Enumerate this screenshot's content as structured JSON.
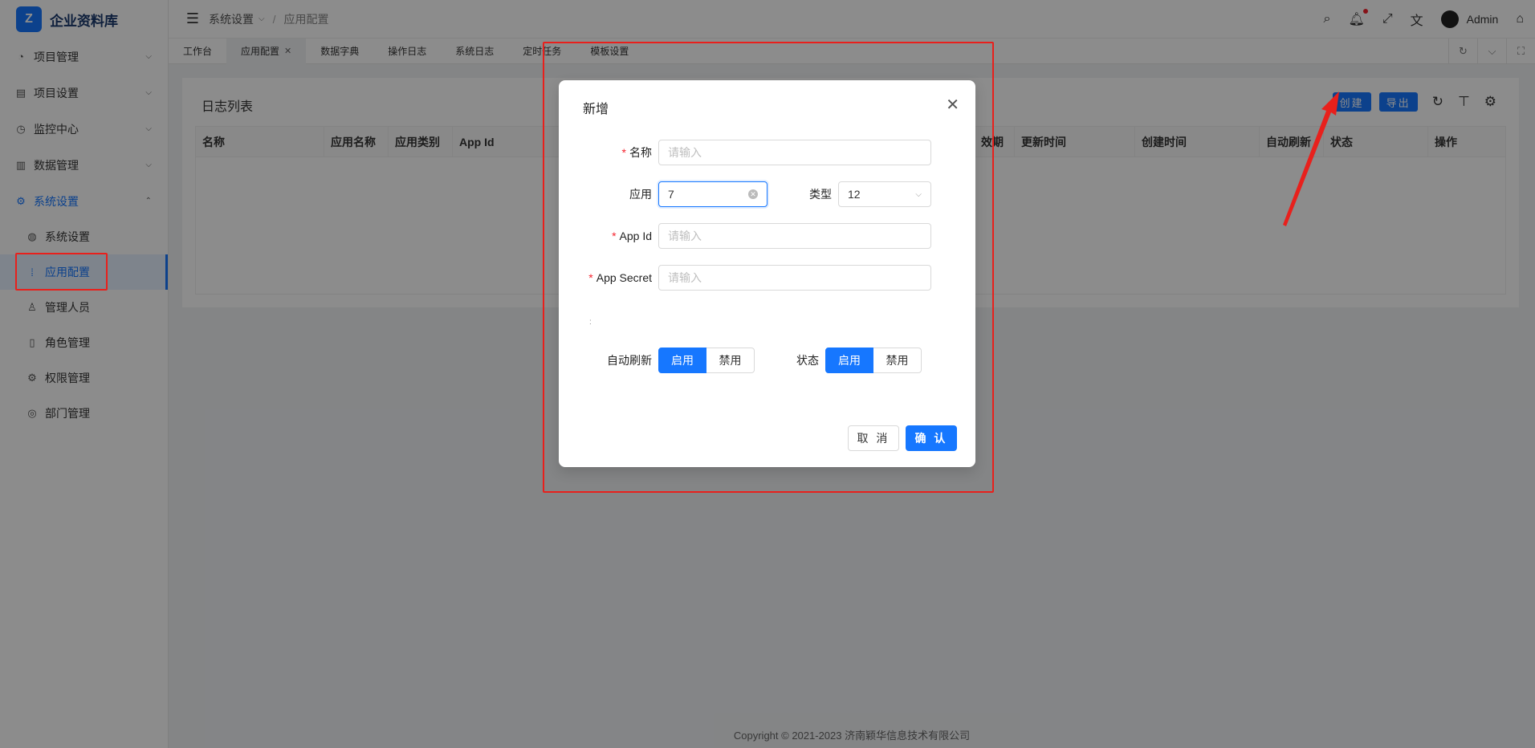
{
  "app": {
    "logo_text": "企业资料库",
    "logo_glyph": "Z"
  },
  "sidebar": {
    "menus": [
      {
        "label": "项目管理",
        "icon": "dashboard-icon"
      },
      {
        "label": "项目设置",
        "icon": "settings-list-icon"
      },
      {
        "label": "监控中心",
        "icon": "monitor-icon"
      },
      {
        "label": "数据管理",
        "icon": "data-icon"
      },
      {
        "label": "系统设置",
        "icon": "gear-icon"
      }
    ],
    "subitems": [
      {
        "label": "系统设置",
        "icon": "globe-icon"
      },
      {
        "label": "应用配置",
        "icon": "grid-dots-icon"
      },
      {
        "label": "管理人员",
        "icon": "user-icon"
      },
      {
        "label": "角色管理",
        "icon": "document-icon"
      },
      {
        "label": "权限管理",
        "icon": "gear-icon"
      },
      {
        "label": "部门管理",
        "icon": "chrome-icon"
      }
    ]
  },
  "header": {
    "breadcrumb_parent": "系统设置",
    "breadcrumb_current": "应用配置",
    "user_name": "Admin"
  },
  "tabs": [
    "工作台",
    "应用配置",
    "数据字典",
    "操作日志",
    "系统日志",
    "定时任务",
    "模板设置"
  ],
  "content": {
    "title": "日志列表",
    "create_label": "创建",
    "export_label": "导出",
    "columns": [
      "名称",
      "应用名称",
      "应用类别",
      "App Id",
      "",
      "效期",
      "更新时间",
      "创建时间",
      "自动刷新",
      "状态",
      "操作"
    ]
  },
  "footer": {
    "copyright": "Copyright © 2021-2023 济南颖华信息技术有限公司"
  },
  "modal": {
    "title": "新增",
    "name_label": "名称",
    "name_placeholder": "请输入",
    "app_label": "应用",
    "app_value": "7",
    "type_label": "类型",
    "type_value": "12",
    "appid_label": "App Id",
    "appid_placeholder": "请输入",
    "secret_label": "App Secret",
    "secret_placeholder": "请输入",
    "tiny_mark": ":",
    "autorefresh_label": "自动刷新",
    "status_label": "状态",
    "enable_label": "启用",
    "disable_label": "禁用",
    "cancel_label": "取 消",
    "confirm_label": "确 认",
    "required_mark": "*"
  },
  "colors": {
    "primary": "#1677ff",
    "annotation": "#e8201c"
  }
}
